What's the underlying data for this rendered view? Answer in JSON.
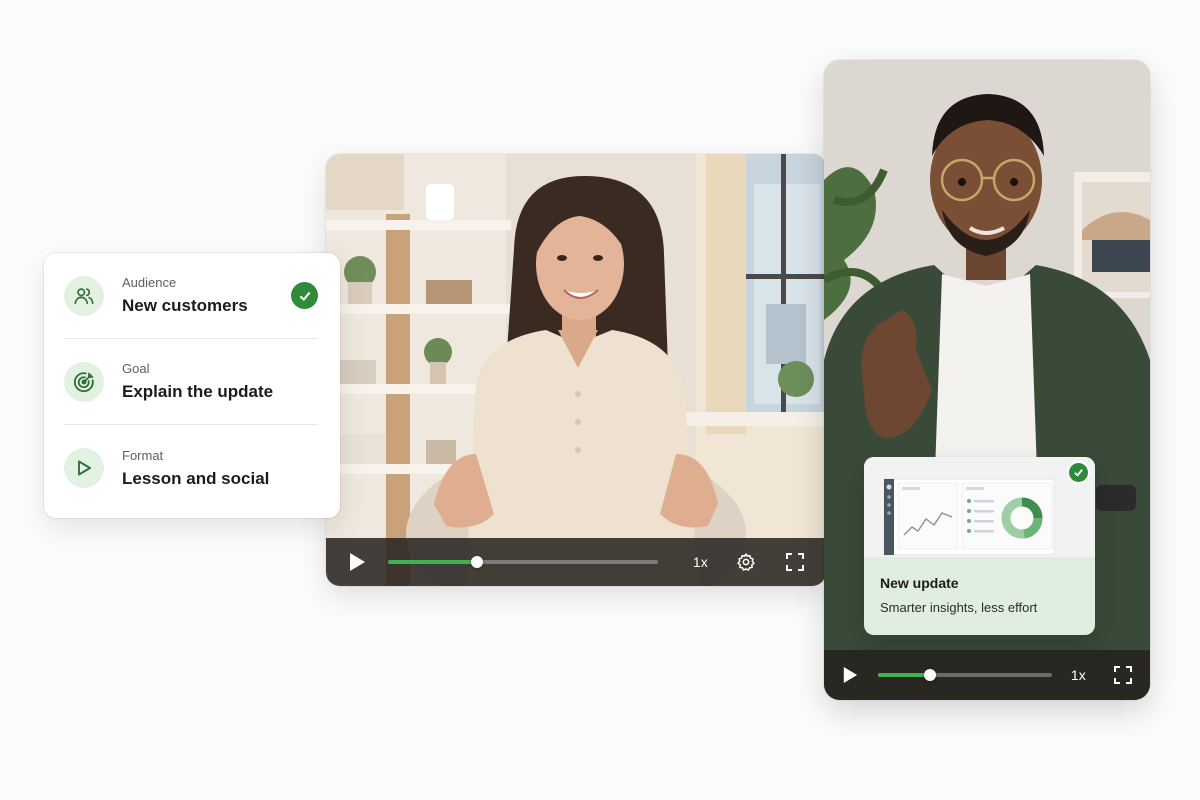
{
  "info_card": {
    "rows": [
      {
        "label": "Audience",
        "value": "New customers",
        "icon": "users-icon",
        "checked": true
      },
      {
        "label": "Goal",
        "value": "Explain the update",
        "icon": "target-icon",
        "checked": false
      },
      {
        "label": "Format",
        "value": "Lesson and social",
        "icon": "play-icon",
        "checked": false
      }
    ]
  },
  "main_video": {
    "speed": "1x",
    "progress": 0.33,
    "controls": [
      "play-icon",
      "gear-icon",
      "fullscreen-icon"
    ]
  },
  "side_video": {
    "speed": "1x",
    "progress": 0.3,
    "controls": [
      "play-icon",
      "fullscreen-icon"
    ]
  },
  "update_card": {
    "title": "New update",
    "subtitle": "Smarter insights, less effort"
  },
  "colors": {
    "accent": "#3fb34f",
    "check": "#2f8a3a",
    "icon_bg": "#e3f1e3",
    "card_tint": "#dfeedf"
  }
}
